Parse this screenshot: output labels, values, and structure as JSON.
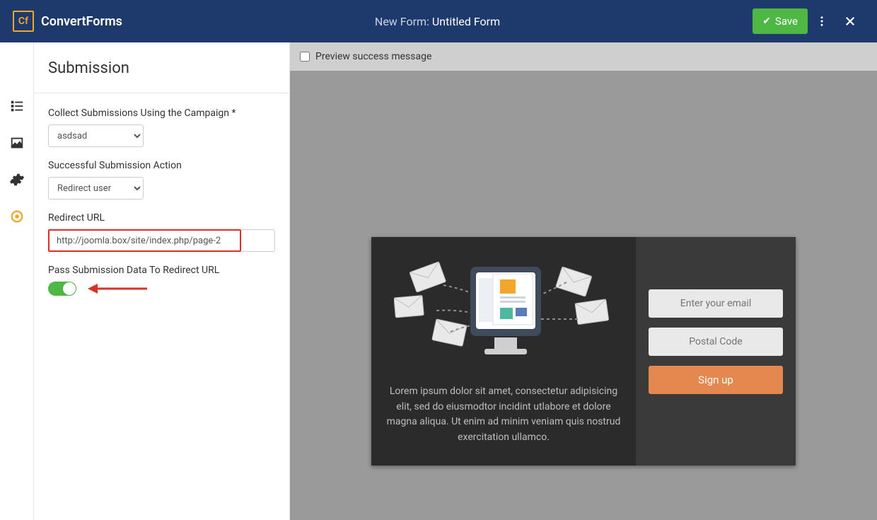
{
  "brand": "ConvertForms",
  "logo_text": "Cf",
  "title": {
    "prefix": "New Form: ",
    "name": "Untitled Form"
  },
  "save_label": "Save",
  "panel": {
    "title": "Submission",
    "campaign_label": "Collect Submissions Using the Campaign *",
    "campaign_value": "asdsad",
    "action_label": "Successful Submission Action",
    "action_value": "Redirect user",
    "redirect_label": "Redirect URL",
    "redirect_value": "http://joomla.box/site/index.php/page-2",
    "passdata_label": "Pass Submission Data To Redirect URL"
  },
  "preview": {
    "checkbox_label": "Preview success message",
    "lorem": "Lorem ipsum dolor sit amet, consectetur adipisicing elit, sed do eiusmodtor incidint utlabore et dolore magna aliqua. Ut enim ad minim veniam quis nostrud exercitation ullamco.",
    "email_placeholder": "Enter your email",
    "postal_placeholder": "Postal Code",
    "signup_label": "Sign up"
  }
}
